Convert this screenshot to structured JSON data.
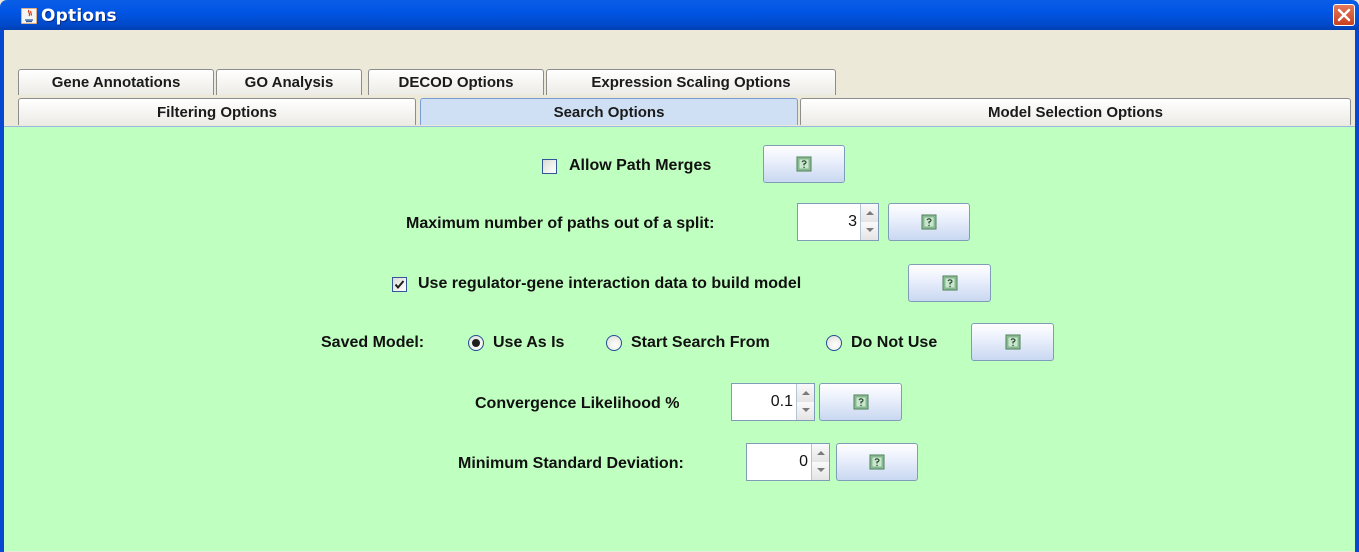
{
  "window": {
    "title": "Options"
  },
  "tabs_row1": [
    "Gene Annotations",
    "GO Analysis",
    "DECOD Options",
    "Expression Scaling Options"
  ],
  "tabs_row2": [
    "Filtering Options",
    "Search Options",
    "Model Selection Options"
  ],
  "selected_tab": "Search Options",
  "search_options": {
    "allow_path_merges": {
      "label": "Allow Path Merges",
      "checked": false
    },
    "max_paths": {
      "label": "Maximum number of paths out of a split:",
      "value": "3"
    },
    "use_regulator": {
      "label": "Use regulator-gene interaction data to build model",
      "checked": true
    },
    "saved_model": {
      "label": "Saved Model:",
      "options": [
        "Use As Is",
        "Start Search From",
        "Do Not Use"
      ],
      "selected": "Use As Is"
    },
    "convergence": {
      "label": "Convergence Likelihood %",
      "value": "0.1"
    },
    "min_std_dev": {
      "label": "Minimum Standard Deviation:",
      "value": "0"
    }
  },
  "icons": {
    "help": "help-icon",
    "close": "close-icon",
    "app": "java-icon"
  },
  "colors": {
    "panel_bg": "#bfffbf",
    "titlebar": "#0054e3",
    "selected_tab": "#cfe0f5"
  }
}
